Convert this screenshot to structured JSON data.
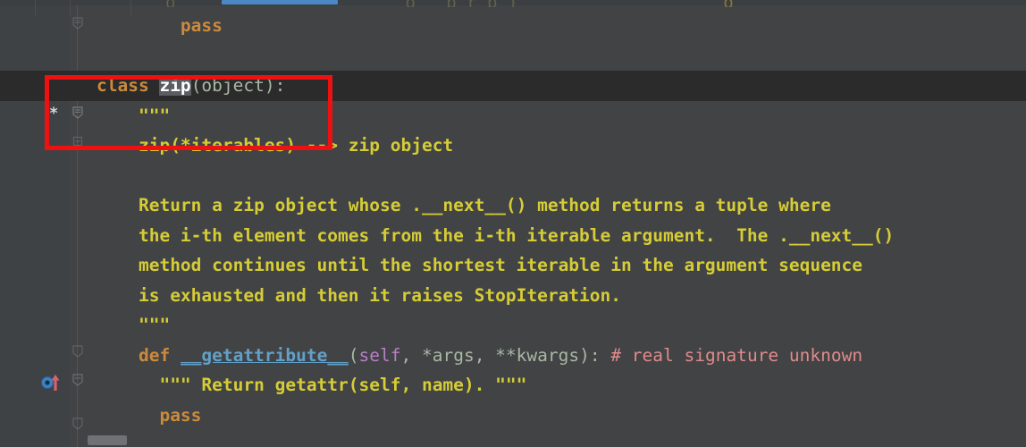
{
  "editor": {
    "theme_name": "darcula",
    "background": "#414345",
    "caret_line_background": "#2b2b2b",
    "gutter_background": "#3f4244",
    "annotation_box_color": "#ee1111"
  },
  "top_bar": {
    "tab_indicator_color": "#4a88c7",
    "ghost_line_left": "g",
    "ghost_line_mid": "o   p r p )",
    "ghost_line_right": "o"
  },
  "gutter": {
    "modified_marker": "*",
    "fold_icon_name": "code-fold-marker",
    "override_icon_name": "overriding-method-icon"
  },
  "code_lines": [
    {
      "id": "line-pass-top",
      "indent": 4,
      "tokens": [
        {
          "text": "pass",
          "kind": "kw"
        }
      ]
    },
    {
      "id": "line-blank-1",
      "indent": 0,
      "tokens": []
    },
    {
      "id": "line-class-zip",
      "indent": 0,
      "highlighted": true,
      "tokens": [
        {
          "text": "class",
          "kind": "kw"
        },
        {
          "text": " ",
          "kind": "punct"
        },
        {
          "text": "zip",
          "kind": "cname"
        },
        {
          "text": "(object):",
          "kind": "punct"
        }
      ]
    },
    {
      "id": "line-doc-open",
      "indent": 2,
      "tokens": [
        {
          "text": "\"\"\"",
          "kind": "doc"
        }
      ]
    },
    {
      "id": "line-doc-sig",
      "indent": 2,
      "tokens": [
        {
          "text": "zip(*iterables) --> zip object",
          "kind": "doc"
        }
      ]
    },
    {
      "id": "line-doc-blank",
      "indent": 0,
      "tokens": []
    },
    {
      "id": "line-doc-1",
      "indent": 2,
      "tokens": [
        {
          "text": "Return a zip object whose .__next__() method returns a tuple where",
          "kind": "doc"
        }
      ]
    },
    {
      "id": "line-doc-2",
      "indent": 2,
      "tokens": [
        {
          "text": "the i-th element comes from the i-th iterable argument.  The .__next__()",
          "kind": "doc"
        }
      ]
    },
    {
      "id": "line-doc-3",
      "indent": 2,
      "tokens": [
        {
          "text": "method continues until the shortest iterable in the argument sequence",
          "kind": "doc"
        }
      ]
    },
    {
      "id": "line-doc-4",
      "indent": 2,
      "tokens": [
        {
          "text": "is exhausted and then it raises StopIteration.",
          "kind": "doc"
        }
      ]
    },
    {
      "id": "line-doc-close",
      "indent": 2,
      "tokens": [
        {
          "text": "\"\"\"",
          "kind": "doc"
        }
      ]
    },
    {
      "id": "line-def-getattribute",
      "indent": 2,
      "tokens": [
        {
          "text": "def",
          "kind": "kw"
        },
        {
          "text": " ",
          "kind": "punct"
        },
        {
          "text": "__getattribute__",
          "kind": "fname"
        },
        {
          "text": "(",
          "kind": "punct"
        },
        {
          "text": "self",
          "kind": "selfkw"
        },
        {
          "text": ", *args, **kwargs):",
          "kind": "param"
        },
        {
          "text": " ",
          "kind": "punct"
        },
        {
          "text": "# real signature unknown",
          "kind": "comment"
        }
      ]
    },
    {
      "id": "line-inner-doc",
      "indent": 3,
      "tokens": [
        {
          "text": "\"\"\" Return getattr(self, name). \"\"\"",
          "kind": "doc"
        }
      ]
    },
    {
      "id": "line-pass-bottom",
      "indent": 3,
      "tokens": [
        {
          "text": "pass",
          "kind": "kw"
        }
      ]
    }
  ]
}
